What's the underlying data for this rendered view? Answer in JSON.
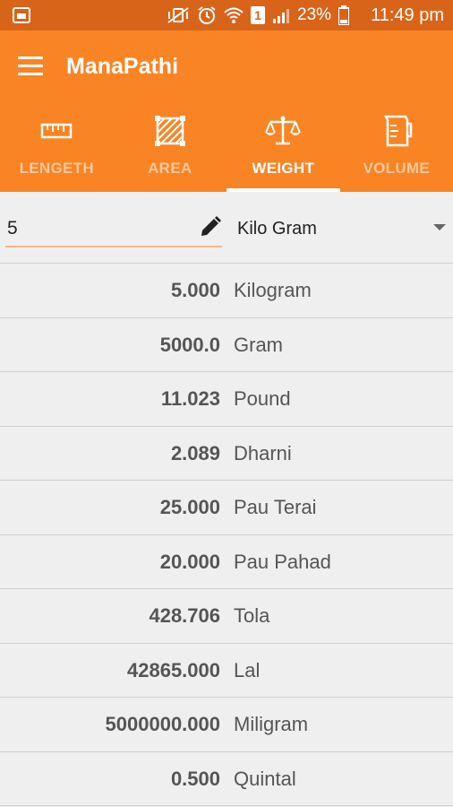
{
  "status_bar": {
    "battery": "23%",
    "sim": "1",
    "time": "11:49 pm"
  },
  "app_bar": {
    "title": "ManaPathi"
  },
  "tabs": [
    {
      "label": "LENGETH",
      "icon": "ruler-icon",
      "active": false
    },
    {
      "label": "AREA",
      "icon": "area-icon",
      "active": false
    },
    {
      "label": "WEIGHT",
      "icon": "scale-icon",
      "active": true
    },
    {
      "label": "VOLUME",
      "icon": "beaker-icon",
      "active": false
    }
  ],
  "converter": {
    "input_value": "5",
    "selected_unit": "Kilo Gram"
  },
  "results": [
    {
      "value": "5.000",
      "unit": "Kilogram"
    },
    {
      "value": "5000.0",
      "unit": "Gram"
    },
    {
      "value": "11.023",
      "unit": "Pound"
    },
    {
      "value": "2.089",
      "unit": "Dharni"
    },
    {
      "value": "25.000",
      "unit": "Pau Terai"
    },
    {
      "value": "20.000",
      "unit": "Pau Pahad"
    },
    {
      "value": "428.706",
      "unit": "Tola"
    },
    {
      "value": "42865.000",
      "unit": "Lal"
    },
    {
      "value": "5000000.000",
      "unit": "Miligram"
    },
    {
      "value": "0.500",
      "unit": "Quintal"
    }
  ],
  "colors": {
    "status_bar": "#d8641a",
    "app_bar": "#f98424",
    "tab_inactive": "#fbc89d",
    "background": "#efefef"
  }
}
